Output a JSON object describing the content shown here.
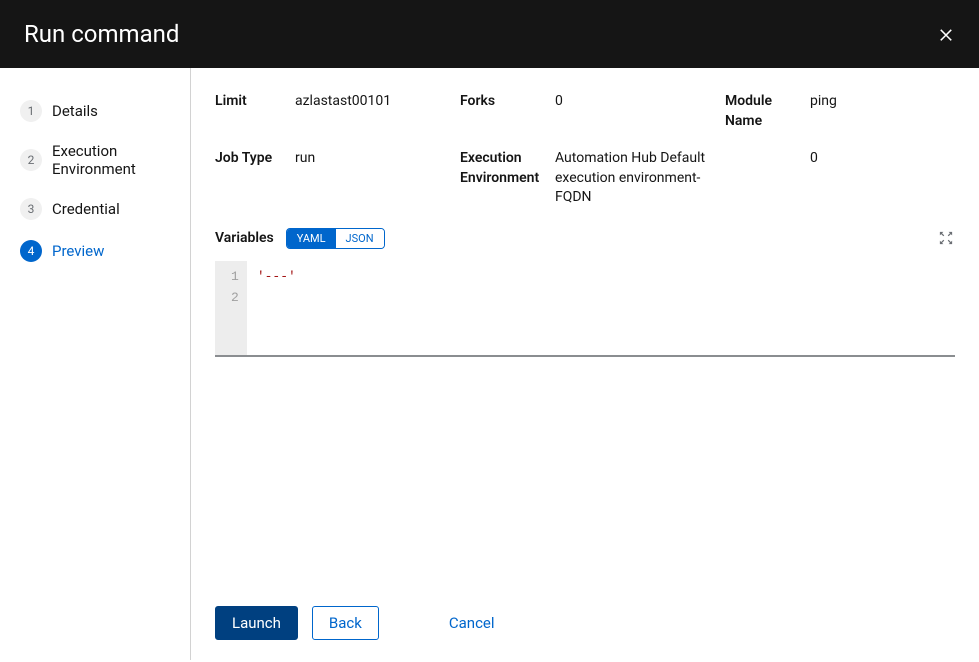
{
  "header": {
    "title": "Run command"
  },
  "sidebar": {
    "steps": [
      {
        "number": "1",
        "label": "Details"
      },
      {
        "number": "2",
        "label": "Execution Environment"
      },
      {
        "number": "3",
        "label": "Credential"
      },
      {
        "number": "4",
        "label": "Preview"
      }
    ],
    "activeIndex": 3
  },
  "preview": {
    "limit_label": "Limit",
    "limit_value": "azlastast00101",
    "forks_label": "Forks",
    "forks_value": "0",
    "module_name_label": "Module Name",
    "module_name_value": "ping",
    "job_type_label": "Job Type",
    "job_type_value": "run",
    "exec_env_label": "Execution Environment",
    "exec_env_value": "Automation Hub Default execution environment-FQDN",
    "verbosity_label": "",
    "verbosity_value": "0",
    "variables_label": "Variables",
    "toggle": {
      "yaml": "YAML",
      "json": "JSON",
      "active": "yaml"
    },
    "code_lines": {
      "line1_num": "1",
      "line2_num": "2",
      "line1_text": "'---'"
    }
  },
  "footer": {
    "launch": "Launch",
    "back": "Back",
    "cancel": "Cancel"
  }
}
